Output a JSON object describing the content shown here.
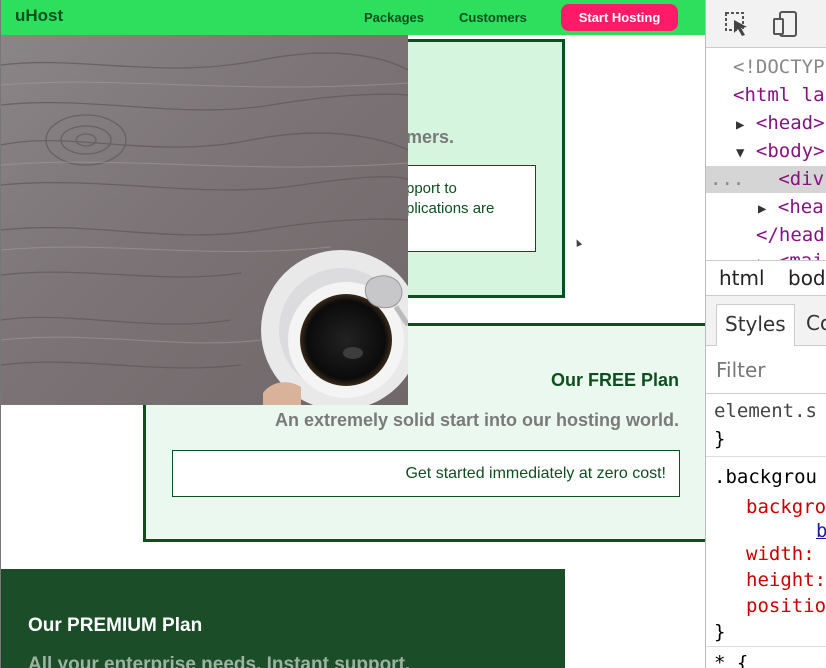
{
  "page": {
    "brand": "uHost",
    "nav": {
      "packages": "Packages",
      "customers": "Customers",
      "cta": "Start Hosting"
    },
    "card_top": {
      "subtitle_partial": "mers.",
      "line1": "pport to",
      "line2": "plications are"
    },
    "free_plan": {
      "title": "Our FREE Plan",
      "subtitle": "An extremely solid start into our hosting world.",
      "text": "Get started immediately at zero cost!"
    },
    "premium_plan": {
      "title": "Our PREMIUM Plan",
      "subtitle": "All your enterprise needs. Instant support."
    }
  },
  "devtools": {
    "code": {
      "doctype": "<!DOCTYP",
      "html": "<html la",
      "head": "<head>",
      "body": "<body>",
      "ellipsis": "...",
      "div": "<div",
      "header_open": "<hea",
      "header_close": "</head",
      "main": "<mai"
    },
    "breadcrumbs": [
      "html",
      "bod"
    ],
    "tabs": {
      "styles": "Styles",
      "computed": "Co"
    },
    "filter_placeholder": "Filter",
    "styles": {
      "element_selector": "element.s",
      "close_brace": "}",
      "rule_selector": ".backgrou",
      "prop_background": "backgro",
      "prop_background_value": "b",
      "prop_width": "width:",
      "prop_height": "height:",
      "prop_position": "positio",
      "rule_close": "}",
      "next_rule": "* {"
    },
    "icons": [
      "inspect-element-icon",
      "device-toolbar-icon"
    ]
  },
  "colors": {
    "navbar": "#2ddf5c",
    "brand_text": "#0e4f1f",
    "cta": "#ff1b68",
    "premium_bg": "#1b4d28",
    "free_bg": "#ebf8ef"
  }
}
